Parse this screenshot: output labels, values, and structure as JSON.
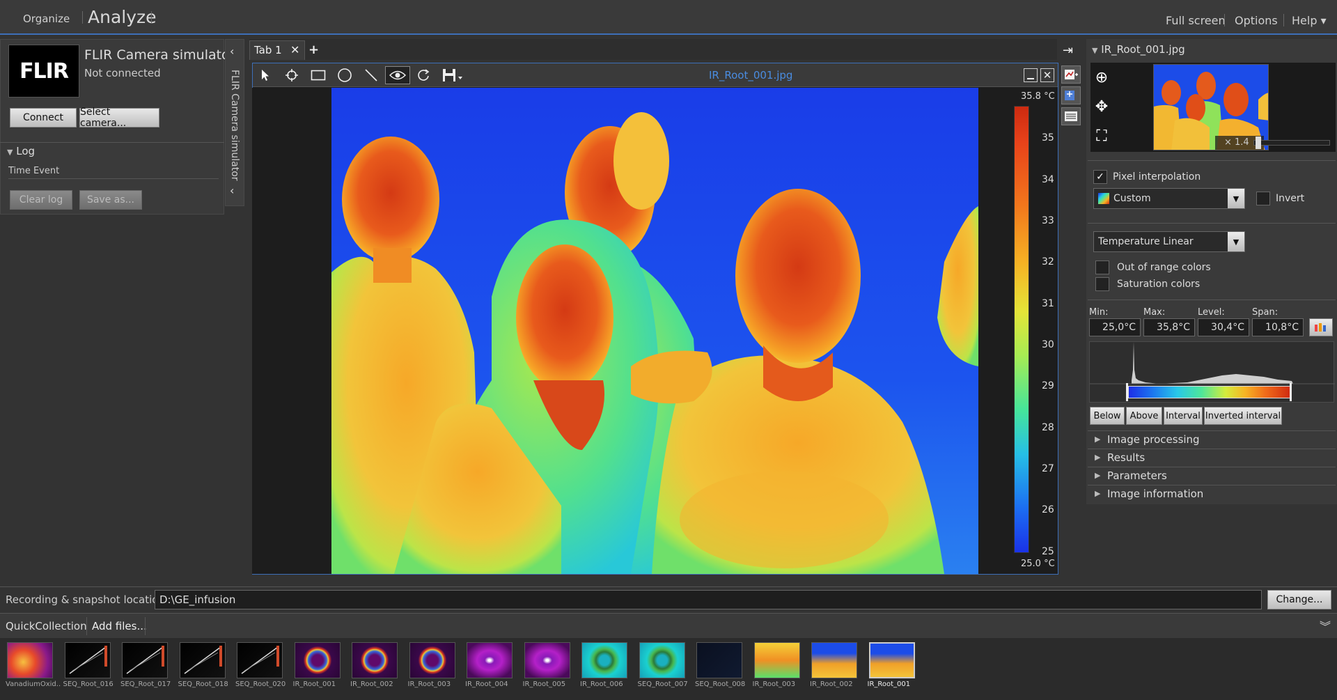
{
  "topbar": {
    "organize": "Organize",
    "analyze": "Analyze",
    "fullscreen": "Full screen",
    "options": "Options",
    "help": "Help ▾"
  },
  "camera": {
    "name": "FLIR Camera simulator",
    "status": "Not connected",
    "logo": "FLIR",
    "connect": "Connect",
    "select": "Select camera...",
    "vertical_title": "FLIR Camera simulator"
  },
  "log": {
    "title": "Log",
    "columns": "Time Event",
    "clear": "Clear log",
    "save": "Save as..."
  },
  "tabs": [
    {
      "label": "Tab 1"
    }
  ],
  "image": {
    "filename": "IR_Root_001.jpg",
    "scale_max": "35.8 °C",
    "scale_min": "25.0 °C",
    "ticks": [
      "35",
      "34",
      "33",
      "32",
      "31",
      "30",
      "29",
      "28",
      "27",
      "26",
      "25"
    ]
  },
  "right": {
    "title": "IR_Root_001.jpg",
    "zoom": "× 1.4",
    "pixel_interp": "Pixel interpolation",
    "palette": "Custom",
    "invert": "Invert",
    "scale_mode": "Temperature Linear",
    "out_of_range": "Out of range colors",
    "saturation": "Saturation colors",
    "min_label": "Min:",
    "max_label": "Max:",
    "level_label": "Level:",
    "span_label": "Span:",
    "min": "25,0°C",
    "max": "35,8°C",
    "level": "30,4°C",
    "span": "10,8°C",
    "buttons": [
      "Below",
      "Above",
      "Interval",
      "Inverted interval"
    ],
    "sections": [
      "Image processing",
      "Results",
      "Parameters",
      "Image information"
    ]
  },
  "recording": {
    "label": "Recording & snapshot location:",
    "path": "D:\\GE_infusion",
    "change": "Change..."
  },
  "quick": {
    "title": "QuickCollection",
    "add": "Add files..."
  },
  "thumbs": [
    {
      "label": "VanadiumOxid..",
      "kind": "vanadium"
    },
    {
      "label": "SEQ_Root_016",
      "kind": "seq"
    },
    {
      "label": "SEQ_Root_017",
      "kind": "seq"
    },
    {
      "label": "SEQ_Root_018",
      "kind": "seq"
    },
    {
      "label": "SEQ_Root_020",
      "kind": "seq"
    },
    {
      "label": "IR_Root_001",
      "kind": "ring"
    },
    {
      "label": "IR_Root_002",
      "kind": "ring"
    },
    {
      "label": "IR_Root_003",
      "kind": "ring"
    },
    {
      "label": "IR_Root_004",
      "kind": "disc"
    },
    {
      "label": "IR_Root_005",
      "kind": "disc"
    },
    {
      "label": "IR_Root_006",
      "kind": "teal"
    },
    {
      "label": "SEQ_Root_007",
      "kind": "teal"
    },
    {
      "label": "SEQ_Root_008",
      "kind": "dark"
    },
    {
      "label": "IR_Root_003",
      "kind": "warm"
    },
    {
      "label": "IR_Root_002",
      "kind": "people"
    },
    {
      "label": "IR_Root_001",
      "kind": "people",
      "selected": true
    }
  ],
  "colors": {
    "accent": "#3d6fb8",
    "panel": "#3a3a3a"
  }
}
